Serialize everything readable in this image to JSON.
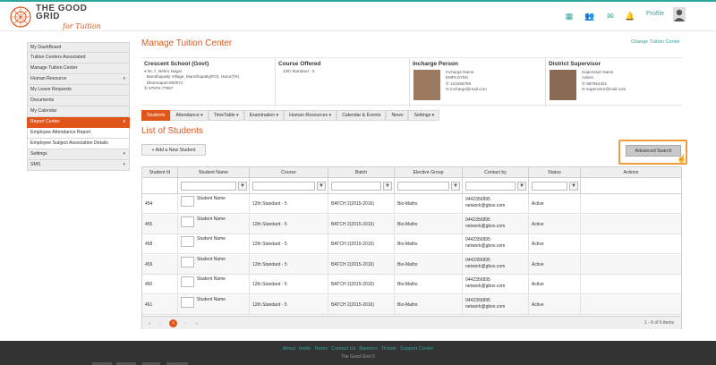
{
  "header": {
    "logo_line1": "THE GOOD",
    "logo_line2": "GRID",
    "logo_tag": "for Tuition",
    "profile_label": "Profile",
    "icons": [
      "grid-icon",
      "users-icon",
      "mail-icon",
      "bell-icon"
    ]
  },
  "sidebar": {
    "items": [
      {
        "label": "My DashBoard"
      },
      {
        "label": "Tuition Centers Associated"
      },
      {
        "label": "Manage Tuition Center"
      },
      {
        "label": "Human Resource",
        "caret": "▾"
      },
      {
        "label": "My Leave Requests"
      },
      {
        "label": "Documents"
      },
      {
        "label": "My Calendar"
      },
      {
        "label": "Report Center",
        "caret": "▾"
      },
      {
        "label": "Employee Attendance Report"
      },
      {
        "label": "Employee Subject Association Details"
      },
      {
        "label": "Settings",
        "caret": "▾"
      },
      {
        "label": "SMS",
        "caret": "▾"
      }
    ]
  },
  "page": {
    "title": "Manage Tuition Center",
    "change_link": "Change Tuition Center",
    "list_title": "List of Students",
    "add_button": "+ Add a New Student",
    "advanced_search": "Advanced Search"
  },
  "info": {
    "school": {
      "name": "Crescent School (Govt)",
      "addr1": "Nc.7, Nehru Nagar",
      "addr2": "Maruthapatty Village, Maruthapatty(PO), Harur(TK)",
      "addr3": "Dharmapuri-600072",
      "phone": "97979-77987"
    },
    "course": {
      "heading": "Course Offered",
      "value": "12th Standard - 5"
    },
    "incharge": {
      "heading": "Incharge Person",
      "name": "Incharge Name",
      "role": "EMPLOYEE",
      "phone": "123456789",
      "email": "incharge@mail.com"
    },
    "supervisor": {
      "heading": "District Supervisor",
      "name": "Supervisor Name",
      "role": "Admin",
      "phone": "987654321",
      "email": "supervisor@mail.com"
    }
  },
  "tabs": [
    {
      "label": "Students",
      "caret": ""
    },
    {
      "label": "Attendance",
      "caret": " ▾"
    },
    {
      "label": "TimeTable",
      "caret": " ▾"
    },
    {
      "label": "Examination",
      "caret": " ▾"
    },
    {
      "label": "Human Resources",
      "caret": " ▾"
    },
    {
      "label": "Calendar & Events",
      "caret": ""
    },
    {
      "label": "News",
      "caret": ""
    },
    {
      "label": "Settings",
      "caret": " ▾"
    }
  ],
  "table": {
    "columns": [
      "Student Id",
      "Student Name",
      "Course",
      "Batch",
      "Elective Group",
      "Contact by",
      "Status",
      "Actions"
    ],
    "rows": [
      {
        "id": "454",
        "name": "Student Name",
        "course": "12th Standard - 5",
        "batch": "BATCH 2(2015-2016)",
        "group": "Bio-Maths",
        "phone": "0442356895",
        "email": "network@gbox.com",
        "status": "Active"
      },
      {
        "id": "455",
        "name": "Student Name",
        "course": "12th Standard - 5",
        "batch": "BATCH 2(2015-2016)",
        "group": "Bio-Maths",
        "phone": "0442356895",
        "email": "network@gbox.com",
        "status": "Active"
      },
      {
        "id": "458",
        "name": "Student Name",
        "course": "12th Standard - 5",
        "batch": "BATCH 2(2015-2016)",
        "group": "Bio-Maths",
        "phone": "0442356895",
        "email": "network@gbox.com",
        "status": "Active"
      },
      {
        "id": "459",
        "name": "Student Name",
        "course": "12th Standard - 5",
        "batch": "BATCH 2(2015-2016)",
        "group": "Bio-Maths",
        "phone": "0442356895",
        "email": "network@gbox.com",
        "status": "Active"
      },
      {
        "id": "460",
        "name": "Student Name",
        "course": "12th Standard - 5",
        "batch": "BATCH 2(2015-2016)",
        "group": "Bio-Maths",
        "phone": "0442356895",
        "email": "network@gbox.com",
        "status": "Active"
      },
      {
        "id": "461",
        "name": "Student Name",
        "course": "12th Standard - 5",
        "batch": "BATCH 2(2015-2016)",
        "group": "Bio-Maths",
        "phone": "0442356895",
        "email": "network@gbox.com",
        "status": "Active"
      }
    ],
    "pager": {
      "first": "«",
      "prev": "‹",
      "current": "1",
      "next": "›",
      "last": "»",
      "info": "1 - 6 of 6 items"
    }
  },
  "footer": {
    "links": [
      "About",
      "Invite",
      "Terms",
      "Contact Us",
      "Banners",
      "Tickets",
      "Support Center"
    ],
    "copyright": "The Good Grid ©"
  },
  "colors": {
    "accent": "#e0561a",
    "teal": "#2fa59c",
    "highlight": "#f39a3c"
  }
}
